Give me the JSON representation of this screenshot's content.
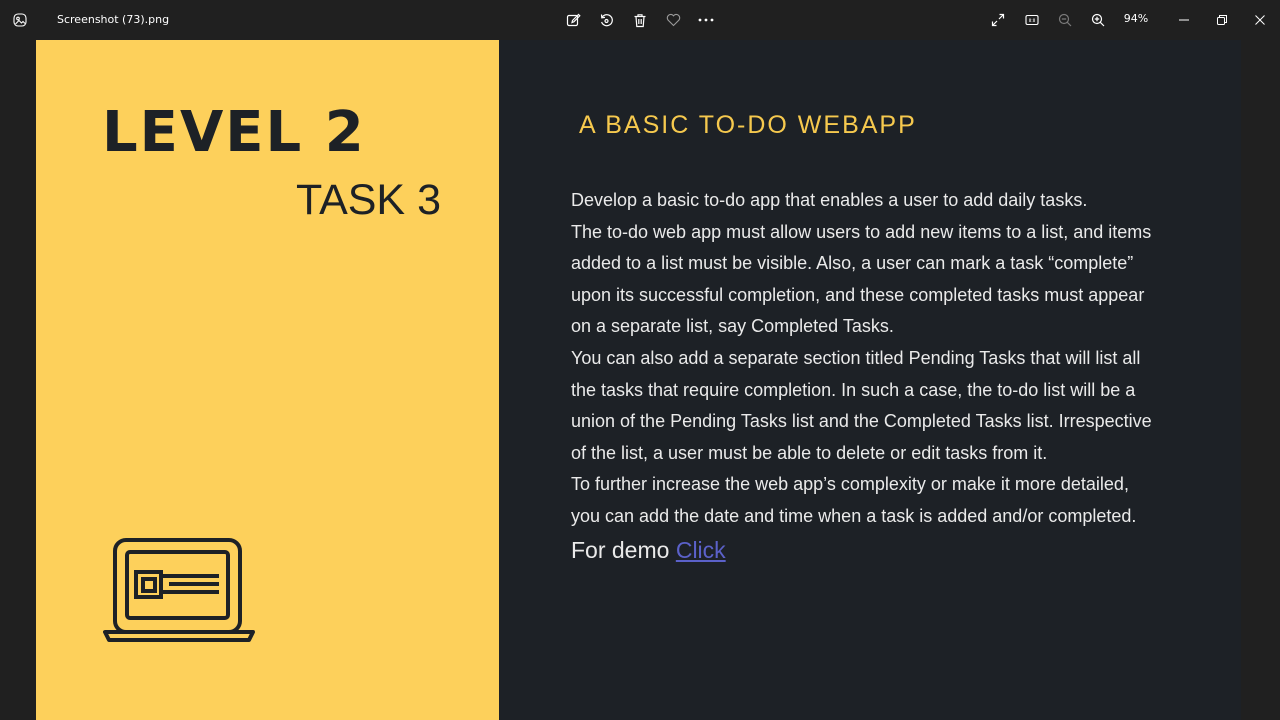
{
  "titlebar": {
    "file_name": "Screenshot (73).png",
    "zoom_level": "94%",
    "icons": [
      "photos-app-icon",
      "edit-image-icon",
      "rotate-icon",
      "delete-icon",
      "favorite-icon",
      "more-icon",
      "fullscreen-icon",
      "actual-size-icon",
      "zoom-out-icon",
      "zoom-in-icon",
      "minimize-icon",
      "restore-icon",
      "close-icon"
    ]
  },
  "slide": {
    "level_heading": "LEVEL 2",
    "task_heading": "TASK 3",
    "title": "A BASIC TO-DO WEBAPP",
    "body_lines": [
      " Develop a basic to-do app that enables a user to add daily tasks.",
      "The to-do web app must allow users to add new items to a list, and items",
      "added to a list must be visible. Also, a user can mark a task “complete”",
      "upon its successful completion, and these completed tasks must appear",
      "on a separate list, say Completed Tasks.",
      "You can also add a separate section titled Pending Tasks that will list all",
      "the tasks that require completion. In such a case, the to-do list will be a",
      "union of the Pending Tasks list and the Completed Tasks list. Irrespective",
      "of the list, a user must be able to delete or edit tasks from it.",
      "To further increase the web app’s complexity or make it more detailed,",
      "you can add the date and time when a task is added and/or completed."
    ],
    "demo_label": "For demo ",
    "demo_link": "Click",
    "laptop_icon": "laptop-icon"
  },
  "colors": {
    "left_panel": "#fdd05b",
    "right_panel": "#1d2126",
    "title_accent": "#f6c94e",
    "link": "#5b61c9",
    "window_chrome": "#202020"
  }
}
